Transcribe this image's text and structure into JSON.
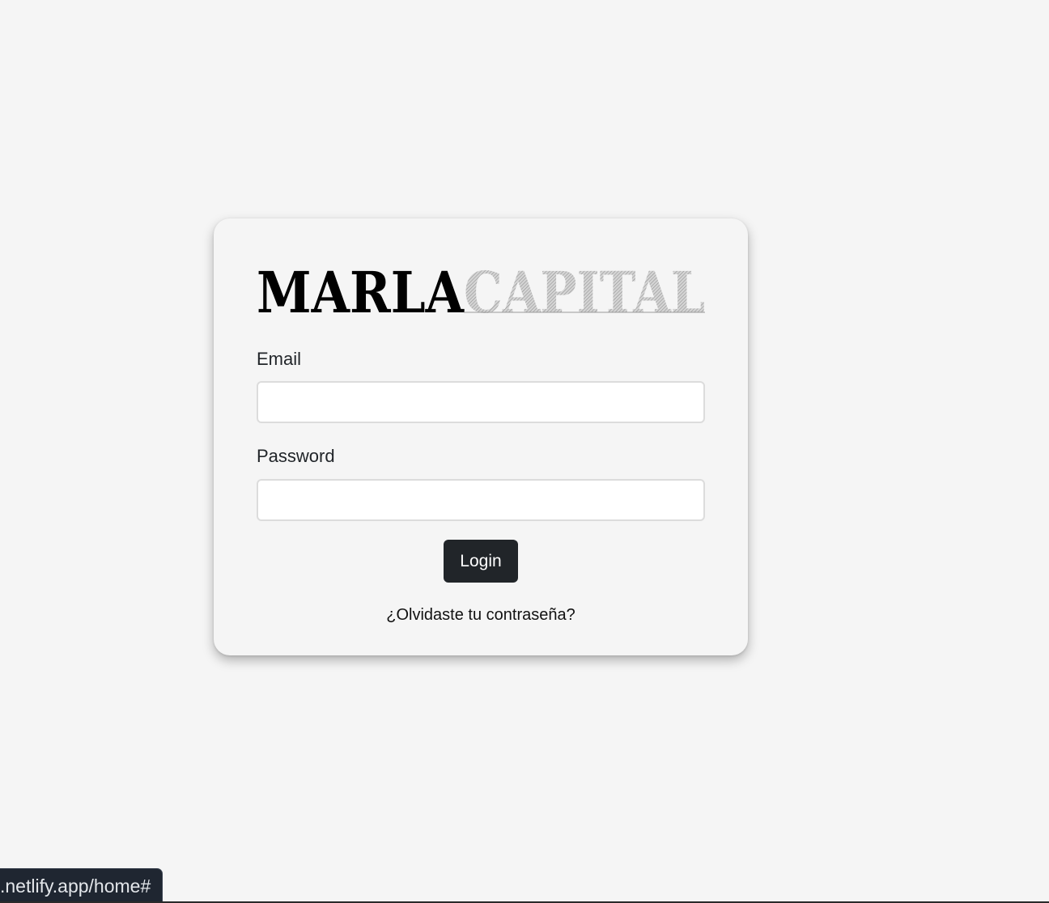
{
  "brand": {
    "logo_text_dark": "MARLA",
    "logo_text_light": "CAPITAL",
    "dark_color": "#000000",
    "light_color": "#b9b9b9"
  },
  "form": {
    "email_label": "Email",
    "email_value": "",
    "password_label": "Password",
    "password_value": "",
    "login_label": "Login",
    "forgot_label": "¿Olvidaste tu contraseña?"
  },
  "status_bar": {
    "url": ".netlify.app/home#"
  },
  "colors": {
    "background": "#f5f5f5",
    "button": "#212529",
    "status_bar": "#1f2631"
  }
}
